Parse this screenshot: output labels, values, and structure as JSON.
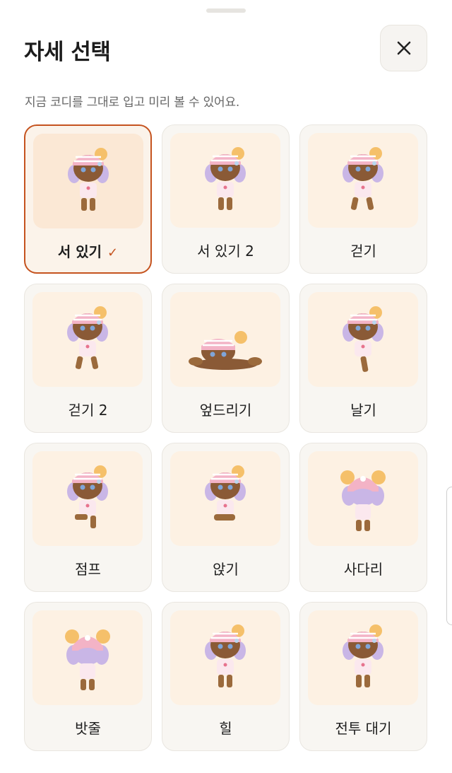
{
  "sheet": {
    "title": "자세 선택",
    "subtitle": "지금 코디를 그대로 입고 미리 볼 수 있어요.",
    "close_icon": "close-icon"
  },
  "accent_color": "#c5531f",
  "selected_index": 0,
  "poses": [
    {
      "label": "서 있기",
      "pose": "stand",
      "selected": true,
      "check_icon": "checkmark-icon"
    },
    {
      "label": "서 있기 2",
      "pose": "stand2",
      "selected": false
    },
    {
      "label": "걷기",
      "pose": "walk",
      "selected": false
    },
    {
      "label": "걷기 2",
      "pose": "walk2",
      "selected": false
    },
    {
      "label": "엎드리기",
      "pose": "prone",
      "selected": false
    },
    {
      "label": "날기",
      "pose": "fly",
      "selected": false
    },
    {
      "label": "점프",
      "pose": "jump",
      "selected": false
    },
    {
      "label": "앉기",
      "pose": "sit",
      "selected": false
    },
    {
      "label": "사다리",
      "pose": "ladder",
      "selected": false
    },
    {
      "label": "밧줄",
      "pose": "rope",
      "selected": false
    },
    {
      "label": "힐",
      "pose": "heal",
      "selected": false
    },
    {
      "label": "전투 대기",
      "pose": "alert",
      "selected": false
    }
  ]
}
